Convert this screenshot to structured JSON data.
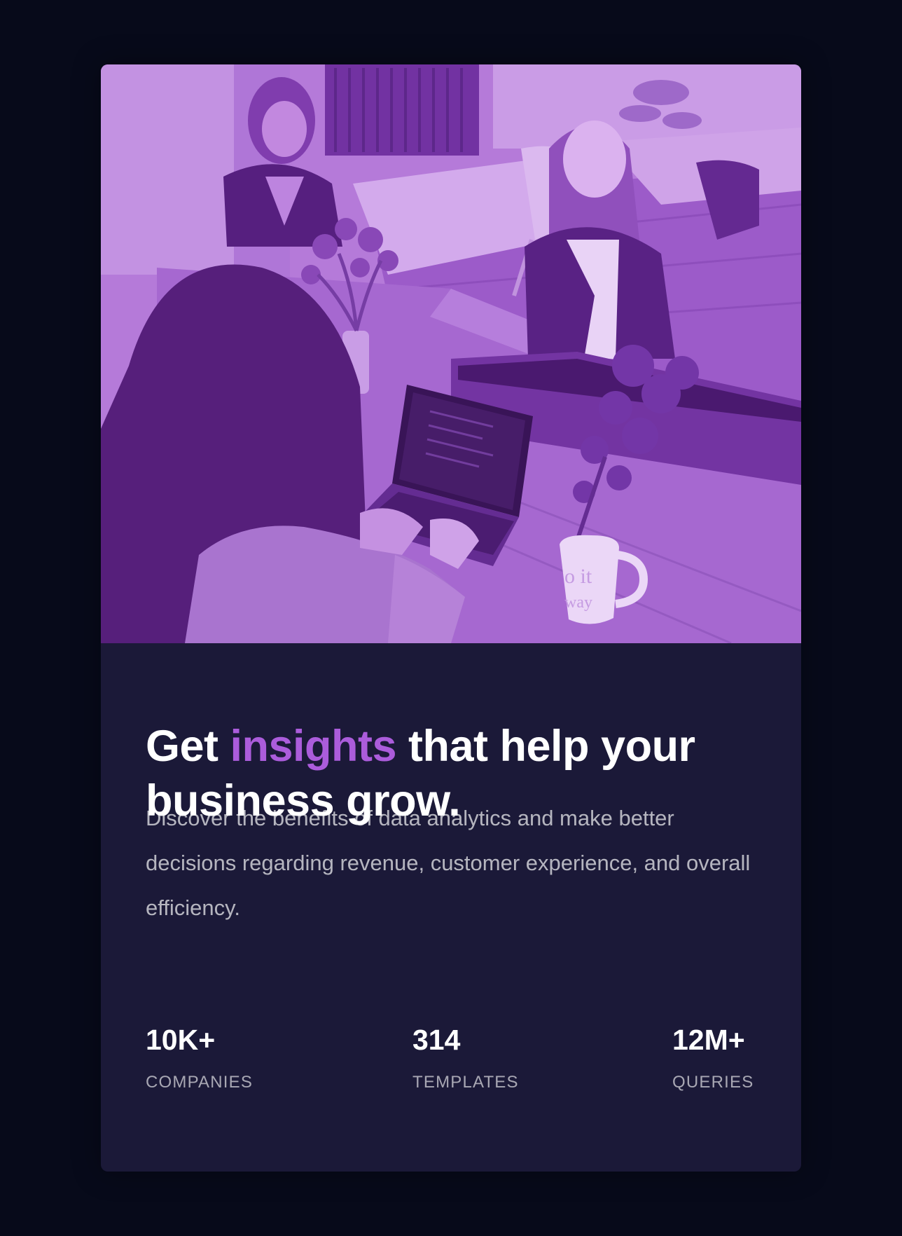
{
  "headline": {
    "prefix": "Get ",
    "accent": "insights",
    "suffix": " that help your business grow."
  },
  "description": "Discover the benefits of data analytics and make better decisions regarding revenue, customer experience, and overall efficiency.",
  "hero": {
    "alt": "Three women working at a shared office table with laptops, flowers and a mug, tinted purple",
    "mug_text_line1": "o it",
    "mug_text_line2": "way"
  },
  "stats": [
    {
      "value": "10K+",
      "label": "COMPANIES"
    },
    {
      "value": "314",
      "label": "TEMPLATES"
    },
    {
      "value": "12M+",
      "label": "QUERIES"
    }
  ],
  "colors": {
    "page_bg": "#070a1a",
    "card_bg": "#1b1938",
    "accent": "#ab5cdb",
    "image_tint": "#aa5cdb"
  }
}
